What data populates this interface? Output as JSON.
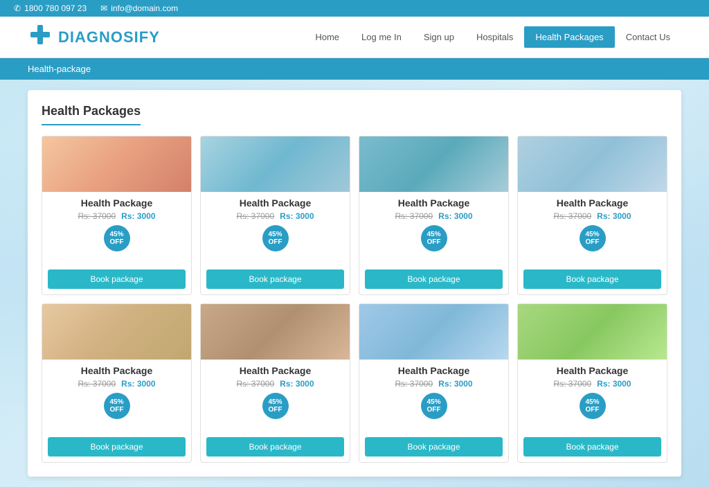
{
  "topbar": {
    "phone_icon": "phone-icon",
    "phone": "1800 780 097 23",
    "email_icon": "email-icon",
    "email": "info@domain.com"
  },
  "header": {
    "logo_text": "DIAGNOSIFY",
    "logo_icon": "plus-icon"
  },
  "nav": {
    "items": [
      {
        "label": "Home",
        "active": false
      },
      {
        "label": "Log me In",
        "active": false
      },
      {
        "label": "Sign up",
        "active": false
      },
      {
        "label": "Hospitals",
        "active": false
      },
      {
        "label": "Health Packages",
        "active": true
      },
      {
        "label": "Contact Us",
        "active": false
      }
    ]
  },
  "breadcrumb": {
    "text": "Health-package"
  },
  "main": {
    "section_title": "Health Packages",
    "packages": [
      {
        "name": "Health Package",
        "price_original": "Rs: 37000",
        "price_discounted": "Rs: 3000",
        "discount": "45%",
        "discount_label": "OFF",
        "book_label": "Book package",
        "img_class": "img-1"
      },
      {
        "name": "Health Package",
        "price_original": "Rs: 37000",
        "price_discounted": "Rs: 3000",
        "discount": "45%",
        "discount_label": "OFF",
        "book_label": "Book package",
        "img_class": "img-2"
      },
      {
        "name": "Health Package",
        "price_original": "Rs: 37000",
        "price_discounted": "Rs: 3000",
        "discount": "45%",
        "discount_label": "OFF",
        "book_label": "Book package",
        "img_class": "img-3"
      },
      {
        "name": "Health Package",
        "price_original": "Rs: 37000",
        "price_discounted": "Rs: 3000",
        "discount": "45%",
        "discount_label": "OFF",
        "book_label": "Book package",
        "img_class": "img-4"
      },
      {
        "name": "Health Package",
        "price_original": "Rs: 37000",
        "price_discounted": "Rs: 3000",
        "discount": "45%",
        "discount_label": "OFF",
        "book_label": "Book package",
        "img_class": "img-5"
      },
      {
        "name": "Health Package",
        "price_original": "Rs: 37000",
        "price_discounted": "Rs: 3000",
        "discount": "45%",
        "discount_label": "OFF",
        "book_label": "Book package",
        "img_class": "img-6"
      },
      {
        "name": "Health Package",
        "price_original": "Rs: 37000",
        "price_discounted": "Rs: 3000",
        "discount": "45%",
        "discount_label": "OFF",
        "book_label": "Book package",
        "img_class": "img-7"
      },
      {
        "name": "Health Package",
        "price_original": "Rs: 37000",
        "price_discounted": "Rs: 3000",
        "discount": "45%",
        "discount_label": "OFF",
        "book_label": "Book package",
        "img_class": "img-8"
      }
    ]
  }
}
